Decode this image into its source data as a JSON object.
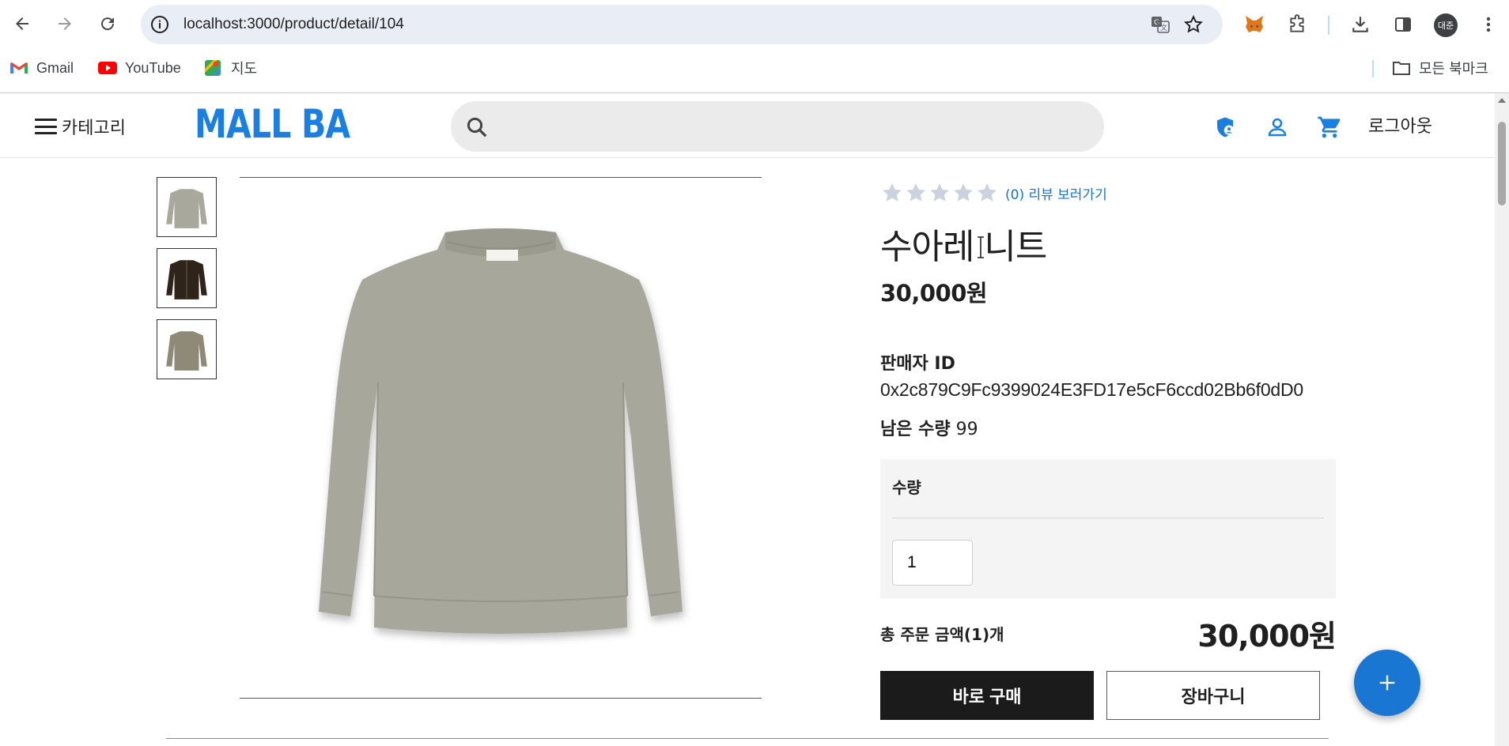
{
  "browser": {
    "url": "localhost:3000/product/detail/104",
    "profile_initials": "대준",
    "bookmarks": [
      {
        "label": "Gmail",
        "icon": "gmail-icon"
      },
      {
        "label": "YouTube",
        "icon": "youtube-icon"
      },
      {
        "label": "지도",
        "icon": "maps-icon"
      }
    ],
    "all_bookmarks_label": "모든 북마크"
  },
  "header": {
    "category_label": "카테고리",
    "logo_text": "MALL BA",
    "search_placeholder": "",
    "logout_label": "로그아웃",
    "brand_color": "#1a7fe0"
  },
  "product": {
    "review_link": "(0) 리뷰 보러가기",
    "rating_stars": 0,
    "rating_max": 5,
    "name": "수아레 니트",
    "price": "30,000원",
    "seller_label": "판매자 ID",
    "seller_id": "0x2c879C9Fc9399024E3FD17e5cF6ccd02Bb6f0dD0",
    "stock_label": "남은 수량",
    "stock_value": "99",
    "thumbnails": [
      {
        "color": "#a8a89c",
        "name": "thumbnail-gray"
      },
      {
        "color": "#2e2419",
        "name": "thumbnail-brown"
      },
      {
        "color": "#8f8a78",
        "name": "thumbnail-khaki"
      }
    ]
  },
  "order": {
    "quantity_label": "수량",
    "quantity_value": "1",
    "total_label": "총 주문 금액(1)개",
    "total_value": "30,000원",
    "buy_now_label": "바로 구매",
    "cart_label": "장바구니"
  }
}
